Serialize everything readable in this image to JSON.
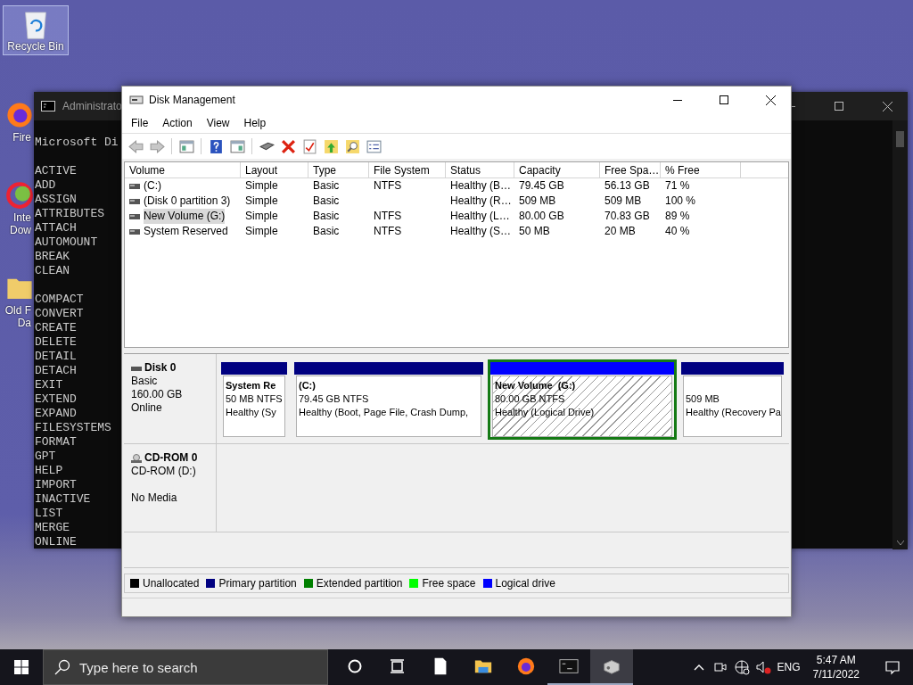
{
  "desktop_icons": [
    {
      "kind": "recycle-bin",
      "label": [
        "Recycle Bin"
      ],
      "selected": true
    },
    {
      "kind": "browser",
      "label": [
        "Fire"
      ],
      "selected": false
    },
    {
      "kind": "downloader",
      "label": [
        "Inte",
        "Dow"
      ],
      "selected": false
    },
    {
      "kind": "folder",
      "label": [
        "Old F",
        "Da"
      ],
      "selected": false
    }
  ],
  "console_window": {
    "title": "Administrato",
    "header": "Microsoft Di",
    "command_groups": [
      [
        "ACTIVE",
        "ADD",
        "ASSIGN",
        "ATTRIBUTES",
        "ATTACH",
        "AUTOMOUNT",
        "BREAK",
        "CLEAN"
      ],
      [
        "COMPACT",
        "CONVERT",
        "CREATE",
        "DELETE",
        "DETAIL",
        "DETACH",
        "EXIT",
        "EXTEND",
        "EXPAND",
        "FILESYSTEMS",
        "FORMAT",
        "GPT",
        "HELP",
        "IMPORT",
        "INACTIVE",
        "LIST",
        "MERGE",
        "ONLINE"
      ]
    ]
  },
  "disk_management": {
    "title": "Disk Management",
    "menu": [
      "File",
      "Action",
      "View",
      "Help"
    ],
    "volumes": {
      "columns": [
        "Volume",
        "Layout",
        "Type",
        "File System",
        "Status",
        "Capacity",
        "Free Spa…",
        "% Free"
      ],
      "rows": [
        {
          "cells": [
            "(C:)",
            "Simple",
            "Basic",
            "NTFS",
            "Healthy (B…",
            "79.45 GB",
            "56.13 GB",
            "71 %"
          ],
          "selected": false
        },
        {
          "cells": [
            "(Disk 0 partition 3)",
            "Simple",
            "Basic",
            "",
            "Healthy (R…",
            "509 MB",
            "509 MB",
            "100 %"
          ],
          "selected": false
        },
        {
          "cells": [
            "New Volume (G:)",
            "Simple",
            "Basic",
            "NTFS",
            "Healthy (L…",
            "80.00 GB",
            "70.83 GB",
            "89 %"
          ],
          "selected": true
        },
        {
          "cells": [
            "System Reserved",
            "Simple",
            "Basic",
            "NTFS",
            "Healthy (S…",
            "50 MB",
            "20 MB",
            "40 %"
          ],
          "selected": false
        }
      ]
    },
    "disks": [
      {
        "kind": "disk",
        "name": "Disk 0",
        "type": "Basic",
        "size": "160.00 GB",
        "status": "Online",
        "partitions": [
          {
            "kind": "primary",
            "name": "System Re",
            "size": "50 MB NTFS",
            "status": "Healthy (Sy",
            "selected": false
          },
          {
            "kind": "primary",
            "name": "(C:)",
            "size": "79.45 GB NTFS",
            "status": "Healthy (Boot, Page File, Crash Dump,",
            "selected": false
          },
          {
            "kind": "logical",
            "name": "New Volume  (G:)",
            "size": "80.00 GB NTFS",
            "status": "Healthy (Logical Drive)",
            "selected": true
          },
          {
            "kind": "primary",
            "size": "509 MB",
            "status": "Healthy (Recovery Pa",
            "selected": false
          }
        ]
      },
      {
        "kind": "cdrom",
        "name": "CD-ROM 0",
        "type": "CD-ROM (D:)",
        "status": "No Media"
      }
    ],
    "legend": [
      {
        "label": "Unallocated",
        "color": "#000000"
      },
      {
        "label": "Primary partition",
        "color": "#000080"
      },
      {
        "label": "Extended partition",
        "color": "#008000"
      },
      {
        "label": "Free space",
        "color": "#00ff00"
      },
      {
        "label": "Logical drive",
        "color": "#0000ff"
      }
    ]
  },
  "taskbar": {
    "search": {
      "placeholder": "Type here to search"
    },
    "apps": [
      {
        "kind": "document",
        "running": false,
        "selected": false
      },
      {
        "kind": "explorer",
        "running": false,
        "selected": false
      },
      {
        "kind": "browser",
        "running": false,
        "selected": false
      },
      {
        "kind": "console",
        "running": true,
        "selected": false
      },
      {
        "kind": "disk-tool",
        "running": true,
        "selected": true
      }
    ],
    "language": "ENG",
    "time": "5:47 AM",
    "date": "7/11/2022"
  }
}
